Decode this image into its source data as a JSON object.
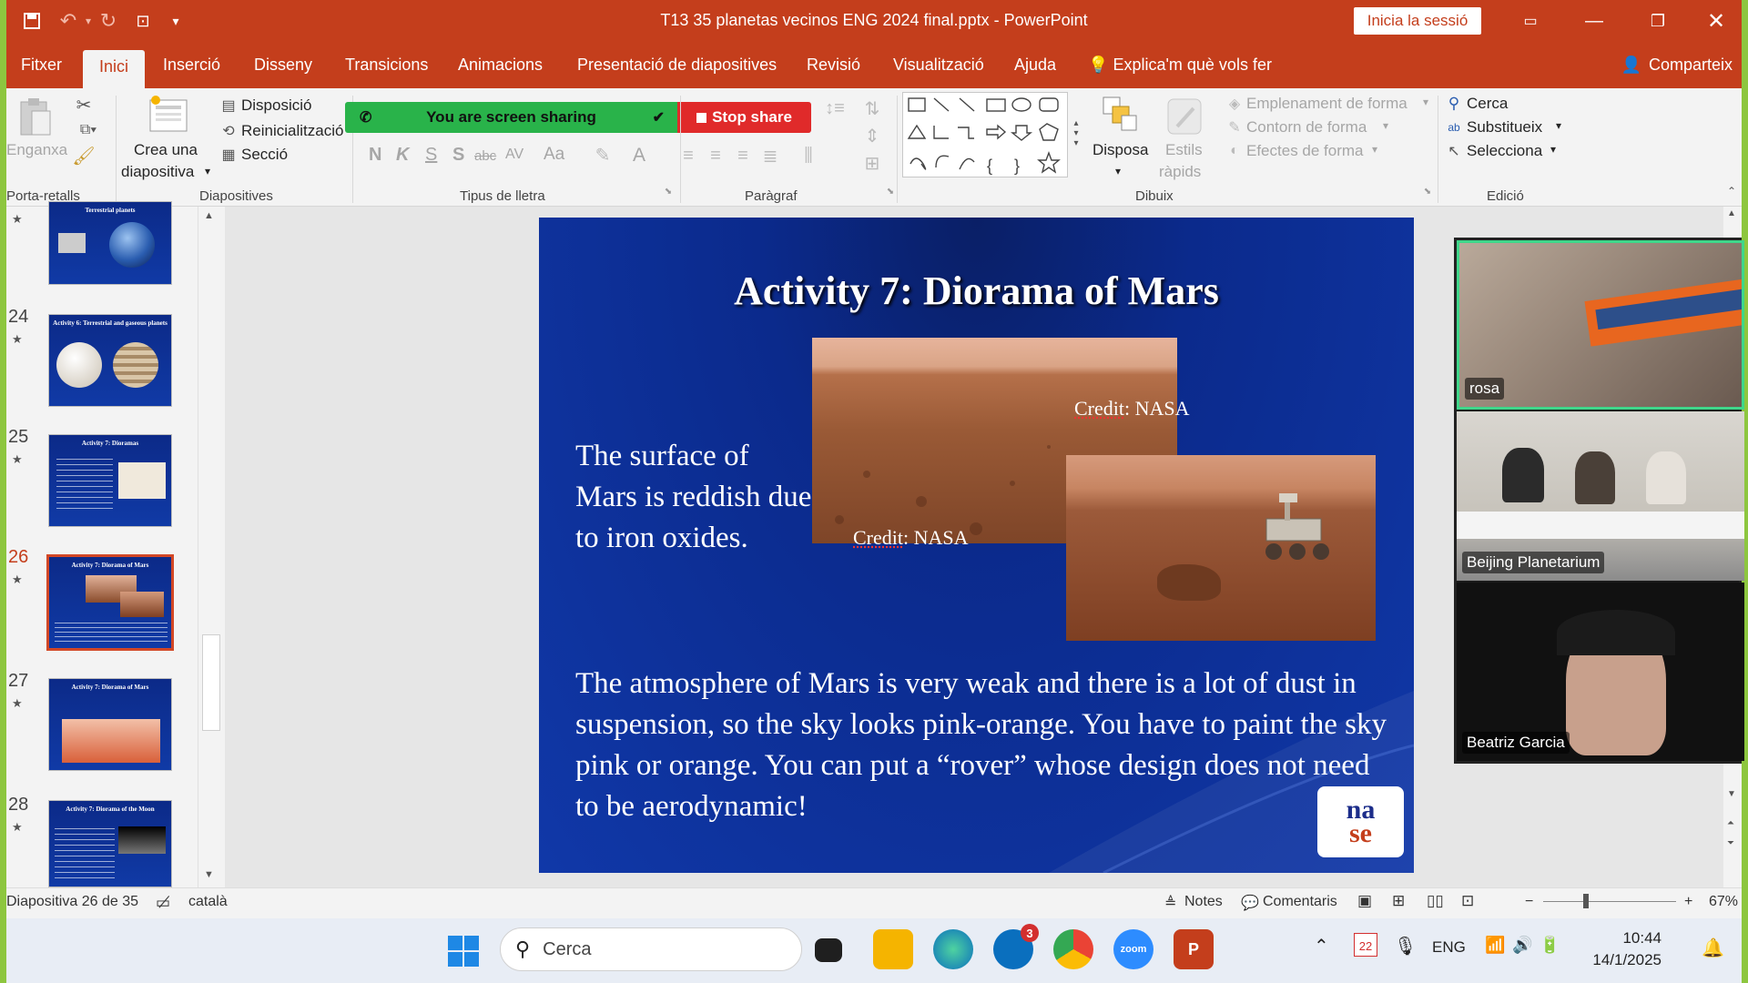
{
  "app": {
    "doc_title": "T13 35 planetas vecinos ENG 2024 final.pptx  -  PowerPoint",
    "signin": "Inicia la sessió"
  },
  "tabs": [
    "Fitxer",
    "Inici",
    "Inserció",
    "Disseny",
    "Transicions",
    "Animacions",
    "Presentació de diapositives",
    "Revisió",
    "Visualització",
    "Ajuda"
  ],
  "tell_me": "Explica'm què vols fer",
  "share": "Comparteix",
  "ribbon": {
    "paste": "Enganxa",
    "new_slide_1": "Crea una",
    "new_slide_2": "diapositiva",
    "layout": "Disposició",
    "reset": "Reinicialització",
    "section": "Secció",
    "screen_sharing": "You are screen sharing",
    "stop_share": "Stop share",
    "arrange": "Disposa",
    "quick_styles_1": "Estils",
    "quick_styles_2": "ràpids",
    "shape_fill": "Emplenament de forma",
    "shape_outline": "Contorn de forma",
    "shape_effects": "Efectes de forma",
    "find": "Cerca",
    "replace": "Substitueix",
    "select": "Selecciona",
    "groups": {
      "clipboard": "Porta-retalls",
      "slides": "Diapositives",
      "font": "Tipus de lletra",
      "paragraph": "Paràgraf",
      "drawing": "Dibuix",
      "editing": "Edició"
    },
    "font_buttons": [
      "N",
      "K",
      "S",
      "S",
      "abc",
      "AV",
      "Aa",
      "A"
    ]
  },
  "thumbnails": [
    {
      "num": "",
      "title": "Terrestrial planets"
    },
    {
      "num": "24",
      "title": "Activity 6: Terrestrial and gaseous planets"
    },
    {
      "num": "25",
      "title": "Activity 7: Dioramas"
    },
    {
      "num": "26",
      "title": "Activity 7: Diorama of Mars"
    },
    {
      "num": "27",
      "title": "Activity 7: Diorama of Mars"
    },
    {
      "num": "28",
      "title": "Activity 7: Diorama of the Moon"
    }
  ],
  "slide": {
    "title": "Activity 7: Diorama of Mars",
    "p1": "The surface of Mars is reddish due to iron oxides.",
    "p2": "The atmosphere of Mars is very weak and there is a lot of dust in suspension, so the sky looks pink-orange. You have to paint the sky pink or orange. You can put a “rover” whose design does not need to be aerodynamic!",
    "credit_word": "Credit",
    "credit_rest": ": NASA",
    "logo_top": "na",
    "logo_bottom": "se"
  },
  "participants": [
    "rosa",
    "Beijing Planetarium",
    "Beatriz Garcia"
  ],
  "status": {
    "slide_of": "Diapositiva 26 de 35",
    "language": "català",
    "notes": "Notes",
    "comments": "Comentaris",
    "zoom": "67%"
  },
  "taskbar": {
    "search": "Cerca",
    "badge": "3",
    "lang": "ENG",
    "time": "10:44",
    "date": "14/1/2025",
    "calendar_day": "22",
    "zoom_app": "zoom"
  }
}
